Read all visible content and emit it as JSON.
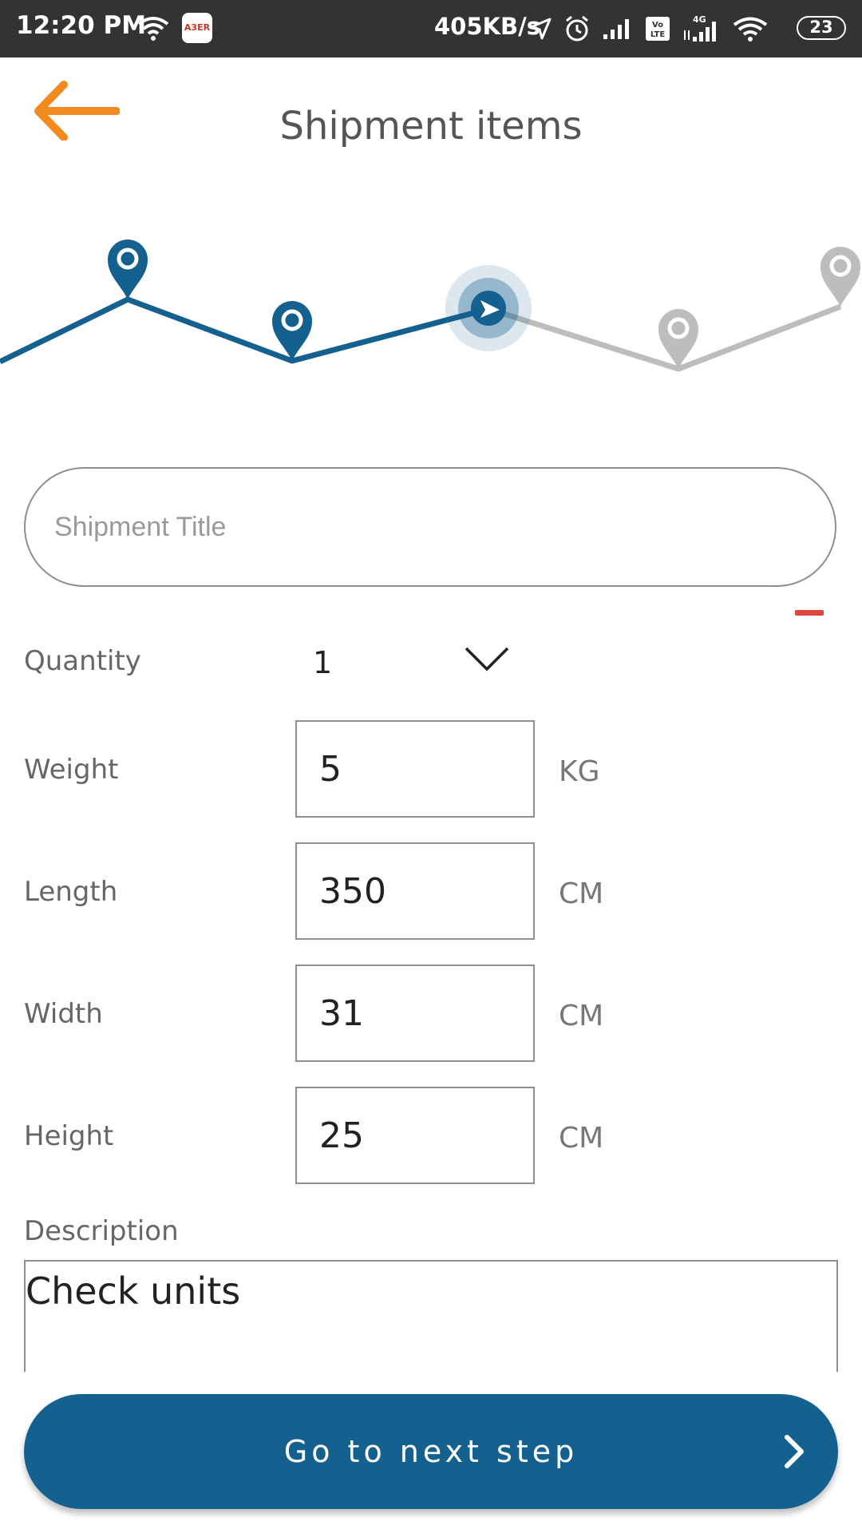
{
  "status_bar": {
    "time": "12:20 PM",
    "app_icon_text": "A3ER",
    "network_speed": "405KB/s",
    "network_type": "4G",
    "volte": "Vo LTE",
    "battery": "23"
  },
  "header": {
    "title": "Shipment items",
    "back_icon": "arrow-left-icon"
  },
  "progress": {
    "steps_total": 5,
    "current_step": 3,
    "active_color": "#14608f",
    "inactive_color": "#bdbdbd"
  },
  "form": {
    "title_placeholder": "Shipment Title",
    "quantity": {
      "label": "Quantity",
      "value": "1"
    },
    "weight": {
      "label": "Weight",
      "value": "5",
      "unit": "KG"
    },
    "length": {
      "label": "Length",
      "value": "350",
      "unit": "CM"
    },
    "width": {
      "label": "Width",
      "value": "31",
      "unit": "CM"
    },
    "height": {
      "label": "Height",
      "value": "25",
      "unit": "CM"
    },
    "description": {
      "label": "Description",
      "value": "Check units"
    }
  },
  "footer": {
    "next_label": "Go to next step"
  },
  "colors": {
    "accent_orange": "#f28a1e",
    "primary_blue": "#14608f",
    "status_bar": "#333333",
    "error_red": "#e0443a"
  }
}
